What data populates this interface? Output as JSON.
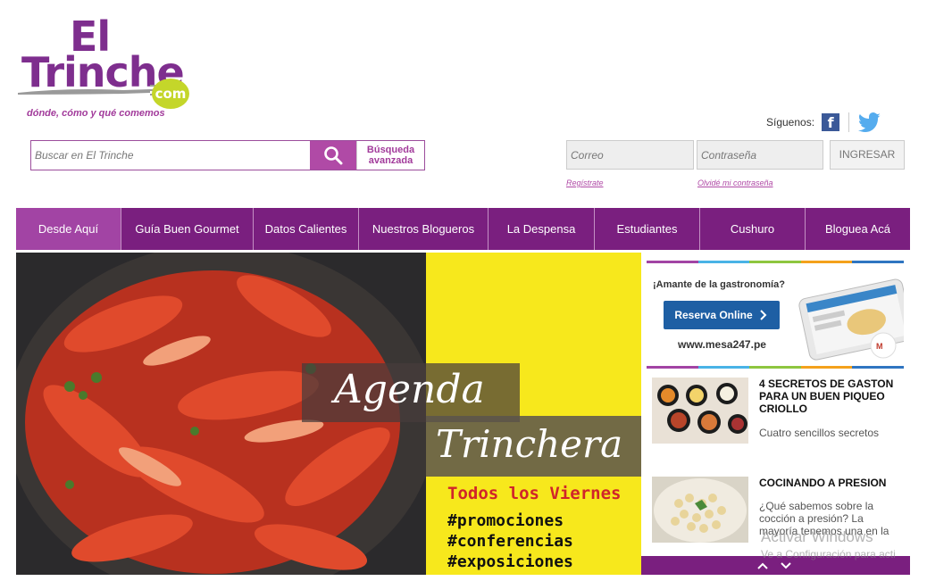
{
  "logo": {
    "line1": "El",
    "line2": "Trinche",
    "domain_badge": "com",
    "tagline": "dónde, cómo y qué comemos"
  },
  "social": {
    "label": "Síguenos:",
    "facebook_glyph": "f",
    "icons": [
      "facebook-icon",
      "twitter-icon"
    ]
  },
  "search": {
    "placeholder": "Buscar en El Trinche",
    "advanced_line1": "Búsqueda",
    "advanced_line2": "avanzada"
  },
  "login": {
    "email_placeholder": "Correo",
    "password_placeholder": "Contraseña",
    "submit_label": "INGRESAR",
    "register_label": "Regístrate",
    "forgot_label": "Olvidé mi contraseña"
  },
  "nav": {
    "items": [
      {
        "label": "Desde Aquí",
        "active": true
      },
      {
        "label": "Guía Buen Gourmet",
        "active": false
      },
      {
        "label": "Datos Calientes",
        "active": false
      },
      {
        "label": "Nuestros Blogueros",
        "active": false
      },
      {
        "label": "La Despensa",
        "active": false
      },
      {
        "label": "Estudiantes",
        "active": false
      },
      {
        "label": "Cushuro",
        "active": false
      },
      {
        "label": "Bloguea Acá",
        "active": false
      }
    ]
  },
  "hero": {
    "title_line1": "Agenda",
    "title_line2": "Trinchera",
    "schedule": "Todos los Viernes",
    "tags": [
      "#promociones",
      "#conferencias",
      "#exposiciones"
    ]
  },
  "ad": {
    "headline": "¡Amante de la gastronomía?",
    "button_label": "Reserva Online",
    "url": "www.mesa247.pe"
  },
  "articles": [
    {
      "title": "4 SECRETOS DE GASTON PARA UN BUEN PIQUEO CRIOLLO",
      "excerpt": "Cuatro sencillos secretos"
    },
    {
      "title": "COCINANDO A PRESION",
      "excerpt": "¿Qué sabemos sobre la cocción a presión? La mayoría tenemos una en la"
    }
  ],
  "system": {
    "watermark_title": "Activar Windows",
    "watermark_sub": "Ve a Configuración para acti"
  },
  "colors": {
    "brand_purple": "#7a1f7f",
    "active_purple": "#a244a4",
    "accent_magenta": "#b04aa6",
    "hero_yellow": "#f7e81c",
    "logo_green": "#c4d62a",
    "ad_blue": "#1e5fa4",
    "rainbow": [
      "#a244a4",
      "#49b3e6",
      "#8ec63f",
      "#f4a11c",
      "#2f75c1"
    ]
  }
}
